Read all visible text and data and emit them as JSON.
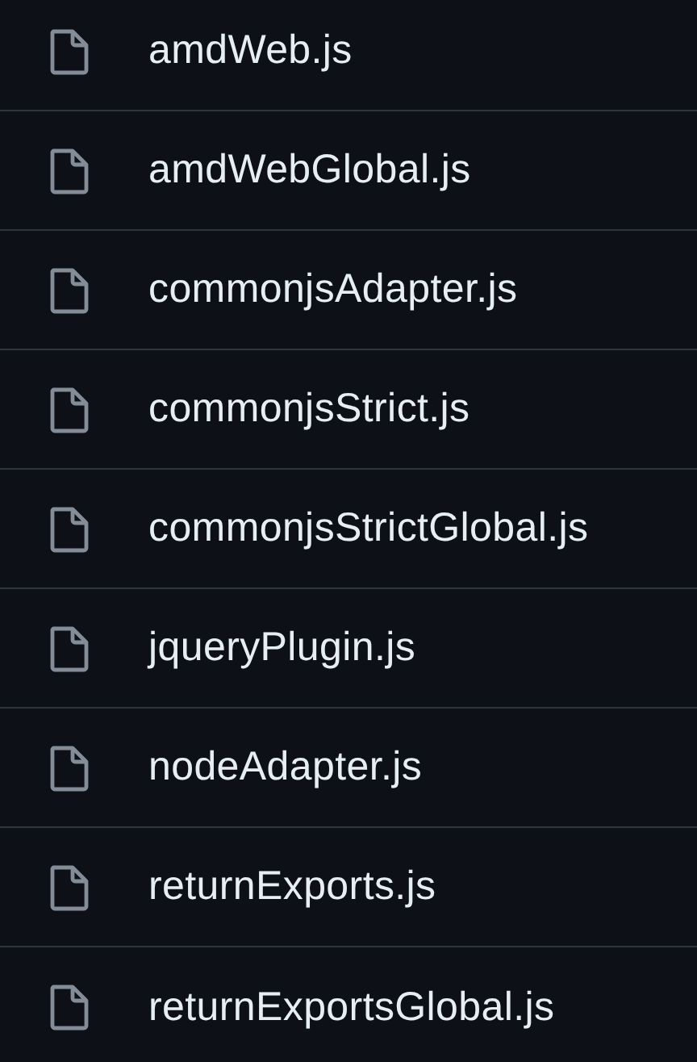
{
  "files": [
    {
      "name": "amdWeb.js"
    },
    {
      "name": "amdWebGlobal.js"
    },
    {
      "name": "commonjsAdapter.js"
    },
    {
      "name": "commonjsStrict.js"
    },
    {
      "name": "commonjsStrictGlobal.js"
    },
    {
      "name": "jqueryPlugin.js"
    },
    {
      "name": "nodeAdapter.js"
    },
    {
      "name": "returnExports.js"
    },
    {
      "name": "returnExportsGlobal.js"
    }
  ]
}
